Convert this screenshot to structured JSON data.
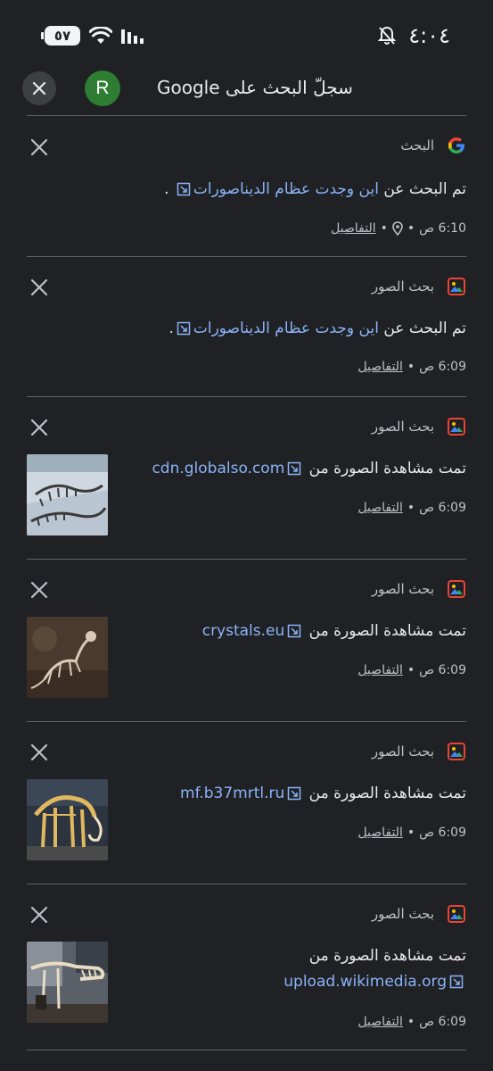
{
  "status_bar": {
    "battery": "٥٧",
    "time": "٤:٠٤"
  },
  "header": {
    "avatar_letter": "R",
    "title": "سجلّ البحث على Google"
  },
  "colors": {
    "background": "#202124",
    "link": "#8ab4f8",
    "divider": "#5f6368",
    "avatar": "#2e7d32"
  },
  "entries": [
    {
      "source": "البحث",
      "source_icon": "google-g-icon",
      "prefix": "تم البحث عن ",
      "link": "اين وجدت عظام الديناصورات",
      "suffix": " .",
      "time": "6:10 ص",
      "has_location": true,
      "details": "التفاصيل"
    },
    {
      "source": "بحث الصور",
      "source_icon": "image-search-icon",
      "prefix": "تم البحث عن ",
      "link": "اين وجدت عظام الديناصورات",
      "suffix": ".",
      "time": "6:09 ص",
      "has_location": false,
      "details": "التفاصيل"
    },
    {
      "source": "بحث الصور",
      "source_icon": "image-search-icon",
      "prefix": "تمت مشاهدة الصورة من ",
      "link": "cdn.globalso.com",
      "time": "6:09 ص",
      "details": "التفاصيل",
      "thumbnail": "dinosaur-skeleton-floor"
    },
    {
      "source": "بحث الصور",
      "source_icon": "image-search-icon",
      "prefix": "تمت مشاهدة الصورة من ",
      "link": "crystals.eu",
      "time": "6:09 ص",
      "details": "التفاصيل",
      "thumbnail": "fossil-in-rock"
    },
    {
      "source": "بحث الصور",
      "source_icon": "image-search-icon",
      "prefix": "تمت مشاهدة الصورة من ",
      "link": "mf.b37mrtl.ru",
      "time": "6:09 ص",
      "details": "التفاصيل",
      "thumbnail": "mammoth-skeleton"
    },
    {
      "source": "بحث الصور",
      "source_icon": "image-search-icon",
      "prefix": "تمت مشاهدة الصورة من",
      "link": "upload.wikimedia.org",
      "time": "6:09 ص",
      "details": "التفاصيل",
      "thumbnail": "museum-dinosaur-skull"
    }
  ]
}
